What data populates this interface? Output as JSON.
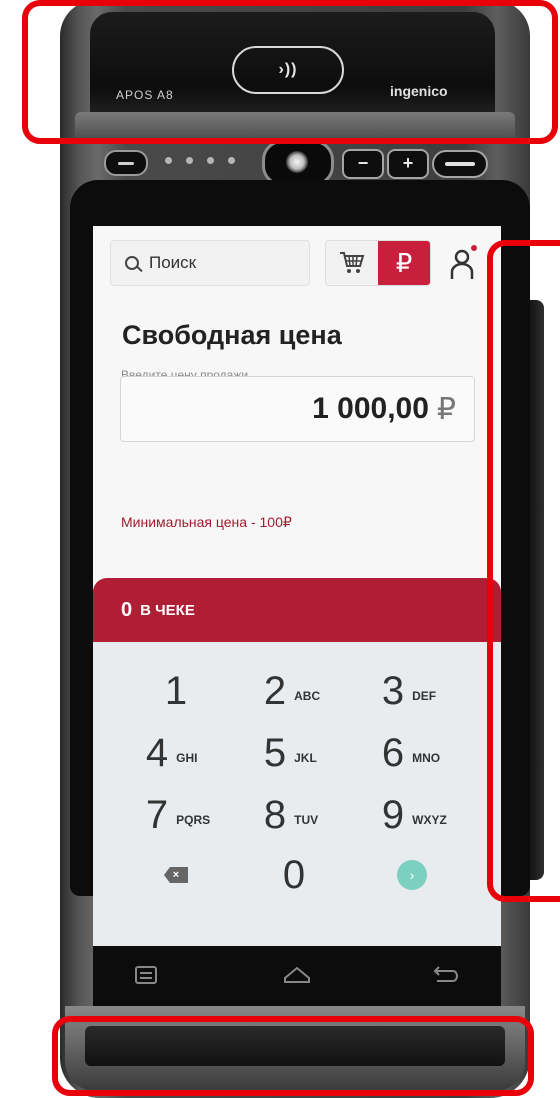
{
  "device": {
    "model": "APOS A8",
    "brand": "ingenico",
    "nfc_symbol": "›))"
  },
  "app": {
    "search": {
      "placeholder": "Поиск"
    },
    "mode_price_symbol": "₽",
    "page_title": "Свободная цена",
    "price_field": {
      "label": "Введите цену продажи",
      "value": "1 000,00",
      "currency": "₽"
    },
    "min_price_note": "Минимальная цена - 100₽",
    "receipt": {
      "count": "0",
      "label": "В ЧЕКЕ"
    },
    "keypad": {
      "keys": [
        {
          "digit": "1",
          "letters": ""
        },
        {
          "digit": "2",
          "letters": "ABC"
        },
        {
          "digit": "3",
          "letters": "DEF"
        },
        {
          "digit": "4",
          "letters": "GHI"
        },
        {
          "digit": "5",
          "letters": "JKL"
        },
        {
          "digit": "6",
          "letters": "MNO"
        },
        {
          "digit": "7",
          "letters": "PQRS"
        },
        {
          "digit": "8",
          "letters": "TUV"
        },
        {
          "digit": "9",
          "letters": "WXYZ"
        },
        {
          "digit": "0",
          "letters": ""
        }
      ],
      "backspace_icon": "backspace-icon",
      "next_icon": "chevron-right-icon",
      "next_symbol": "›",
      "backspace_symbol": "×"
    }
  },
  "colors": {
    "accent": "#c8203c",
    "receipt_bar": "#b01e35",
    "next_button": "#7cd0c0",
    "annotation": "#e8000b"
  }
}
